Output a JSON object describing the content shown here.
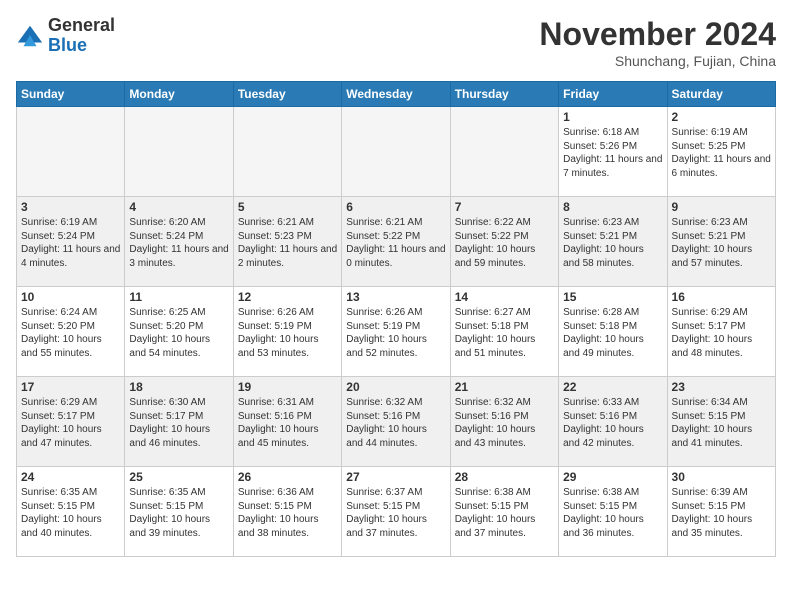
{
  "logo": {
    "general": "General",
    "blue": "Blue"
  },
  "header": {
    "month": "November 2024",
    "location": "Shunchang, Fujian, China"
  },
  "weekdays": [
    "Sunday",
    "Monday",
    "Tuesday",
    "Wednesday",
    "Thursday",
    "Friday",
    "Saturday"
  ],
  "weeks": [
    [
      {
        "day": "",
        "sunrise": "",
        "sunset": "",
        "daylight": "",
        "empty": true
      },
      {
        "day": "",
        "sunrise": "",
        "sunset": "",
        "daylight": "",
        "empty": true
      },
      {
        "day": "",
        "sunrise": "",
        "sunset": "",
        "daylight": "",
        "empty": true
      },
      {
        "day": "",
        "sunrise": "",
        "sunset": "",
        "daylight": "",
        "empty": true
      },
      {
        "day": "",
        "sunrise": "",
        "sunset": "",
        "daylight": "",
        "empty": true
      },
      {
        "day": "1",
        "sunrise": "Sunrise: 6:18 AM",
        "sunset": "Sunset: 5:26 PM",
        "daylight": "Daylight: 11 hours and 7 minutes.",
        "empty": false
      },
      {
        "day": "2",
        "sunrise": "Sunrise: 6:19 AM",
        "sunset": "Sunset: 5:25 PM",
        "daylight": "Daylight: 11 hours and 6 minutes.",
        "empty": false
      }
    ],
    [
      {
        "day": "3",
        "sunrise": "Sunrise: 6:19 AM",
        "sunset": "Sunset: 5:24 PM",
        "daylight": "Daylight: 11 hours and 4 minutes.",
        "empty": false
      },
      {
        "day": "4",
        "sunrise": "Sunrise: 6:20 AM",
        "sunset": "Sunset: 5:24 PM",
        "daylight": "Daylight: 11 hours and 3 minutes.",
        "empty": false
      },
      {
        "day": "5",
        "sunrise": "Sunrise: 6:21 AM",
        "sunset": "Sunset: 5:23 PM",
        "daylight": "Daylight: 11 hours and 2 minutes.",
        "empty": false
      },
      {
        "day": "6",
        "sunrise": "Sunrise: 6:21 AM",
        "sunset": "Sunset: 5:22 PM",
        "daylight": "Daylight: 11 hours and 0 minutes.",
        "empty": false
      },
      {
        "day": "7",
        "sunrise": "Sunrise: 6:22 AM",
        "sunset": "Sunset: 5:22 PM",
        "daylight": "Daylight: 10 hours and 59 minutes.",
        "empty": false
      },
      {
        "day": "8",
        "sunrise": "Sunrise: 6:23 AM",
        "sunset": "Sunset: 5:21 PM",
        "daylight": "Daylight: 10 hours and 58 minutes.",
        "empty": false
      },
      {
        "day": "9",
        "sunrise": "Sunrise: 6:23 AM",
        "sunset": "Sunset: 5:21 PM",
        "daylight": "Daylight: 10 hours and 57 minutes.",
        "empty": false
      }
    ],
    [
      {
        "day": "10",
        "sunrise": "Sunrise: 6:24 AM",
        "sunset": "Sunset: 5:20 PM",
        "daylight": "Daylight: 10 hours and 55 minutes.",
        "empty": false
      },
      {
        "day": "11",
        "sunrise": "Sunrise: 6:25 AM",
        "sunset": "Sunset: 5:20 PM",
        "daylight": "Daylight: 10 hours and 54 minutes.",
        "empty": false
      },
      {
        "day": "12",
        "sunrise": "Sunrise: 6:26 AM",
        "sunset": "Sunset: 5:19 PM",
        "daylight": "Daylight: 10 hours and 53 minutes.",
        "empty": false
      },
      {
        "day": "13",
        "sunrise": "Sunrise: 6:26 AM",
        "sunset": "Sunset: 5:19 PM",
        "daylight": "Daylight: 10 hours and 52 minutes.",
        "empty": false
      },
      {
        "day": "14",
        "sunrise": "Sunrise: 6:27 AM",
        "sunset": "Sunset: 5:18 PM",
        "daylight": "Daylight: 10 hours and 51 minutes.",
        "empty": false
      },
      {
        "day": "15",
        "sunrise": "Sunrise: 6:28 AM",
        "sunset": "Sunset: 5:18 PM",
        "daylight": "Daylight: 10 hours and 49 minutes.",
        "empty": false
      },
      {
        "day": "16",
        "sunrise": "Sunrise: 6:29 AM",
        "sunset": "Sunset: 5:17 PM",
        "daylight": "Daylight: 10 hours and 48 minutes.",
        "empty": false
      }
    ],
    [
      {
        "day": "17",
        "sunrise": "Sunrise: 6:29 AM",
        "sunset": "Sunset: 5:17 PM",
        "daylight": "Daylight: 10 hours and 47 minutes.",
        "empty": false
      },
      {
        "day": "18",
        "sunrise": "Sunrise: 6:30 AM",
        "sunset": "Sunset: 5:17 PM",
        "daylight": "Daylight: 10 hours and 46 minutes.",
        "empty": false
      },
      {
        "day": "19",
        "sunrise": "Sunrise: 6:31 AM",
        "sunset": "Sunset: 5:16 PM",
        "daylight": "Daylight: 10 hours and 45 minutes.",
        "empty": false
      },
      {
        "day": "20",
        "sunrise": "Sunrise: 6:32 AM",
        "sunset": "Sunset: 5:16 PM",
        "daylight": "Daylight: 10 hours and 44 minutes.",
        "empty": false
      },
      {
        "day": "21",
        "sunrise": "Sunrise: 6:32 AM",
        "sunset": "Sunset: 5:16 PM",
        "daylight": "Daylight: 10 hours and 43 minutes.",
        "empty": false
      },
      {
        "day": "22",
        "sunrise": "Sunrise: 6:33 AM",
        "sunset": "Sunset: 5:16 PM",
        "daylight": "Daylight: 10 hours and 42 minutes.",
        "empty": false
      },
      {
        "day": "23",
        "sunrise": "Sunrise: 6:34 AM",
        "sunset": "Sunset: 5:15 PM",
        "daylight": "Daylight: 10 hours and 41 minutes.",
        "empty": false
      }
    ],
    [
      {
        "day": "24",
        "sunrise": "Sunrise: 6:35 AM",
        "sunset": "Sunset: 5:15 PM",
        "daylight": "Daylight: 10 hours and 40 minutes.",
        "empty": false
      },
      {
        "day": "25",
        "sunrise": "Sunrise: 6:35 AM",
        "sunset": "Sunset: 5:15 PM",
        "daylight": "Daylight: 10 hours and 39 minutes.",
        "empty": false
      },
      {
        "day": "26",
        "sunrise": "Sunrise: 6:36 AM",
        "sunset": "Sunset: 5:15 PM",
        "daylight": "Daylight: 10 hours and 38 minutes.",
        "empty": false
      },
      {
        "day": "27",
        "sunrise": "Sunrise: 6:37 AM",
        "sunset": "Sunset: 5:15 PM",
        "daylight": "Daylight: 10 hours and 37 minutes.",
        "empty": false
      },
      {
        "day": "28",
        "sunrise": "Sunrise: 6:38 AM",
        "sunset": "Sunset: 5:15 PM",
        "daylight": "Daylight: 10 hours and 37 minutes.",
        "empty": false
      },
      {
        "day": "29",
        "sunrise": "Sunrise: 6:38 AM",
        "sunset": "Sunset: 5:15 PM",
        "daylight": "Daylight: 10 hours and 36 minutes.",
        "empty": false
      },
      {
        "day": "30",
        "sunrise": "Sunrise: 6:39 AM",
        "sunset": "Sunset: 5:15 PM",
        "daylight": "Daylight: 10 hours and 35 minutes.",
        "empty": false
      }
    ]
  ]
}
